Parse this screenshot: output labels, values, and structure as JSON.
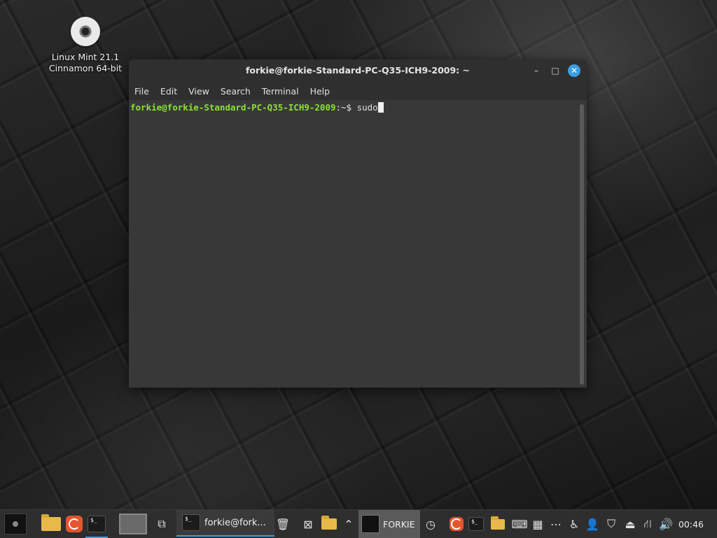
{
  "desktop": {
    "icon_label_line1": "Linux Mint 21.1",
    "icon_label_line2": "Cinnamon 64-bit"
  },
  "window": {
    "title": "forkie@forkie-Standard-PC-Q35-ICH9-2009: ~",
    "menu": [
      "File",
      "Edit",
      "View",
      "Search",
      "Terminal",
      "Help"
    ],
    "prompt_user": "forkie@forkie-Standard-PC-Q35-ICH9-2009",
    "prompt_symbol": ":~$ ",
    "command": "sudo"
  },
  "taskbar": {
    "terminal_task_label": "forkie@fork...",
    "workspace_label": "FORKIE",
    "clock": "00:46"
  },
  "colors": {
    "prompt_green": "#8ae234",
    "accent_blue": "#3b9ee6",
    "folder_yellow": "#e8b94a",
    "firefox_orange": "#e5562f"
  }
}
